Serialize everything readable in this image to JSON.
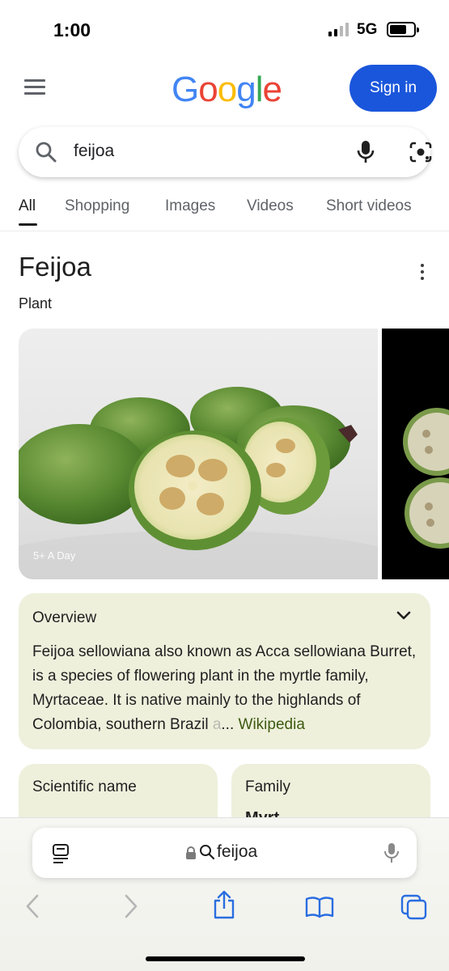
{
  "status_bar": {
    "time": "1:00",
    "network": "5G"
  },
  "header": {
    "logo_letters": [
      "G",
      "o",
      "o",
      "g",
      "l",
      "e"
    ],
    "sign_in_label": "Sign in",
    "sign_in_color": "#1a56db"
  },
  "search": {
    "query": "feijoa"
  },
  "tabs": [
    {
      "label": "All",
      "active": true
    },
    {
      "label": "Shopping"
    },
    {
      "label": "Images"
    },
    {
      "label": "Videos"
    },
    {
      "label": "Short videos"
    }
  ],
  "entity": {
    "title": "Feijoa",
    "subtitle": "Plant",
    "image_caption": "5+ A Day"
  },
  "overview": {
    "heading": "Overview",
    "text": "Feijoa sellowiana also known as Acca sellowiana Burret, is a species of flowering plant in the myrtle family, Myrtaceae. It is native mainly to the highlands of Colombia, southern Brazil ",
    "text_faded": "a",
    "ellipsis": "...",
    "source": "Wikipedia",
    "card_color": "#eef0dc",
    "source_color": "#3e5a11"
  },
  "facts": [
    {
      "label": "Scientific name",
      "value": ""
    },
    {
      "label": "Family",
      "value": "Myrt"
    }
  ],
  "browser": {
    "url_text": "feijoa"
  }
}
